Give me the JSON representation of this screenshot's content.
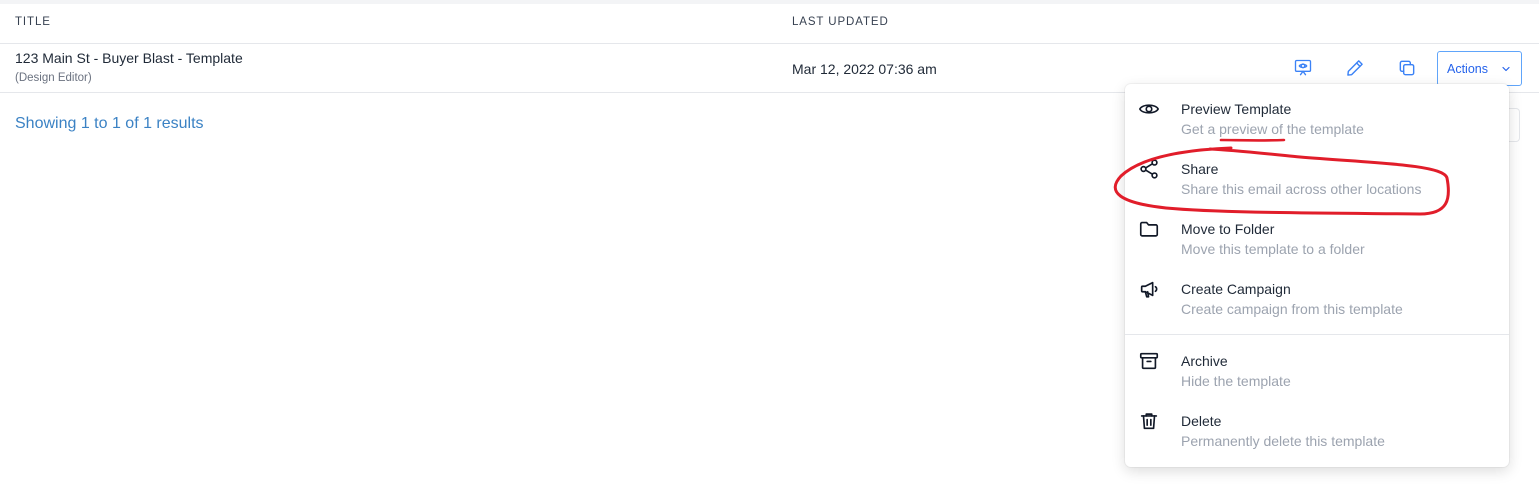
{
  "table": {
    "headers": {
      "title": "TITLE",
      "last_updated": "LAST UPDATED"
    },
    "rows": [
      {
        "title": "123 Main St - Buyer Blast - Template",
        "subtitle": "(Design Editor)",
        "last_updated": "Mar 12, 2022 07:36 am",
        "actions_label": "Actions"
      }
    ]
  },
  "results_text": "Showing 1 to 1 of 1 results",
  "actions_menu": {
    "items": [
      {
        "icon": "eye-icon",
        "label": "Preview Template",
        "description": "Get a preview of the template"
      },
      {
        "icon": "share-icon",
        "label": "Share",
        "description": "Share this email across other locations"
      },
      {
        "icon": "folder-icon",
        "label": "Move to Folder",
        "description": "Move this template to a folder"
      },
      {
        "icon": "megaphone-icon",
        "label": "Create Campaign",
        "description": "Create campaign from this template"
      },
      {
        "icon": "archive-icon",
        "label": "Archive",
        "description": "Hide the template"
      },
      {
        "icon": "trash-icon",
        "label": "Delete",
        "description": "Permanently delete this template"
      }
    ]
  },
  "colors": {
    "accent": "#2563eb",
    "link": "#3b82c4",
    "annotation": "#e11d2a"
  }
}
